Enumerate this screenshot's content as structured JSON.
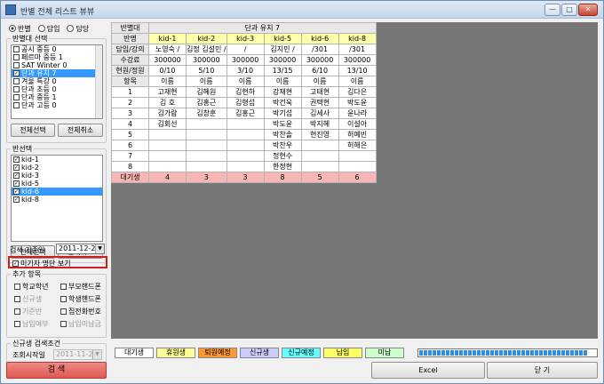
{
  "window": {
    "title": "반별 전체 리스트 뷰뷰",
    "min": "—",
    "max": "□",
    "close": "✕"
  },
  "radios": [
    {
      "label": "반별",
      "checked": true
    },
    {
      "label": "담임",
      "checked": false
    },
    {
      "label": "담당",
      "checked": false
    }
  ],
  "class_select": {
    "title": "반별대 선택",
    "items": [
      {
        "label": "공시 중등 0",
        "checked": false,
        "selected": false
      },
      {
        "label": "페르마 중등 1",
        "checked": false,
        "selected": false
      },
      {
        "label": "SAT Winter 0",
        "checked": false,
        "selected": false
      },
      {
        "label": "단과 유치 7",
        "checked": true,
        "selected": true
      },
      {
        "label": "겨울 특강 0",
        "checked": false,
        "selected": false
      },
      {
        "label": "단과 초등 0",
        "checked": false,
        "selected": false
      },
      {
        "label": "단과 중등 1",
        "checked": false,
        "selected": false
      },
      {
        "label": "단과 고등 0",
        "checked": false,
        "selected": false
      }
    ],
    "select_all": "전체선택",
    "clear_all": "전체취소"
  },
  "class_list": {
    "title": "반선택",
    "items": [
      {
        "label": "kid-1",
        "checked": true,
        "selected": false
      },
      {
        "label": "kid-2",
        "checked": true,
        "selected": false
      },
      {
        "label": "kid-3",
        "checked": true,
        "selected": false
      },
      {
        "label": "kid-5",
        "checked": true,
        "selected": false
      },
      {
        "label": "kid-6",
        "checked": true,
        "selected": true
      },
      {
        "label": "kid-8",
        "checked": true,
        "selected": false
      }
    ],
    "select_all": "전체선택",
    "clear_all": "전체취소"
  },
  "search": {
    "date_label": "검색 기준일",
    "date_value": "2011-12-29",
    "preview_label": "미기자 명단 보기"
  },
  "extra_items": {
    "title": "추가 항목",
    "items": [
      {
        "label": "학교학년",
        "checked": false,
        "active": true
      },
      {
        "label": "부모핸드폰",
        "checked": false,
        "active": true
      },
      {
        "label": "신규생",
        "checked": false,
        "active": false
      },
      {
        "label": "학생핸드폰",
        "checked": false,
        "active": true
      },
      {
        "label": "기준반",
        "checked": false,
        "active": false
      },
      {
        "label": "집전화번호",
        "checked": false,
        "active": true
      },
      {
        "label": "납입여부",
        "checked": false,
        "active": false
      },
      {
        "label": "납입미납금",
        "checked": false,
        "active": false
      }
    ]
  },
  "new_search": {
    "title": "신규생 검색조건",
    "start_label": "조회시작일",
    "start_value": "2011-11-29",
    "end_label": "조회종료일",
    "end_value": "2011-12-29"
  },
  "search_button": "검 색",
  "grid": {
    "group_header": [
      "반별대",
      "단과 유치 7"
    ],
    "row_labels": [
      "반명",
      "담임/강의",
      "수강료",
      "현원/정원",
      "항목"
    ],
    "numbers": [
      "1",
      "2",
      "3",
      "4",
      "5",
      "6",
      "7",
      "8"
    ],
    "wait_label": "대기생",
    "columns": [
      {
        "class": "kid-1",
        "teacher": "노영숙 /",
        "fee": "300000",
        "count": "0/10",
        "item": "이름",
        "students": [
          "고재현",
          "김 호",
          "김가람",
          "김회선",
          "",
          "",
          "",
          ""
        ],
        "wait": "4"
      },
      {
        "class": "kid-2",
        "teacher": "김정 김설민 /",
        "fee": "300000",
        "count": "5/10",
        "item": "이름",
        "students": [
          "김혜원",
          "김홍근",
          "김창훈",
          "",
          "",
          "",
          "",
          ""
        ],
        "wait": "3"
      },
      {
        "class": "kid-3",
        "teacher": "/",
        "fee": "300000",
        "count": "3/10",
        "item": "이름",
        "students": [
          "김현하",
          "김형섭",
          "김홍근",
          "",
          "",
          "",
          "",
          ""
        ],
        "wait": "3"
      },
      {
        "class": "kid-5",
        "teacher": "김지민 /",
        "fee": "300000",
        "count": "13/15",
        "item": "이름",
        "students": [
          "강재현",
          "박건욱",
          "박기섭",
          "박도윤",
          "박찬솔",
          "박찬우",
          "정현수",
          "한정현"
        ],
        "wait": "8"
      },
      {
        "class": "kid-6",
        "teacher": "/301",
        "fee": "300000",
        "count": "6/10",
        "item": "이름",
        "students": [
          "고태현",
          "권택현",
          "김세사",
          "박지혜",
          "현진영",
          "",
          "",
          ""
        ],
        "wait": "5"
      },
      {
        "class": "kid-8",
        "teacher": "/301",
        "fee": "300000",
        "count": "13/10",
        "item": "이름",
        "students": [
          "김다은",
          "박도윤",
          "윤나라",
          "이설아",
          "허예빈",
          "허해은",
          "",
          ""
        ],
        "wait": "6"
      }
    ]
  },
  "legend": [
    {
      "label": "대기생",
      "color": "#ffffff"
    },
    {
      "label": "휴원생",
      "color": "#ffff99"
    },
    {
      "label": "퇴원예정",
      "color": "#ff9933"
    },
    {
      "label": "신규생",
      "color": "#ccccff"
    },
    {
      "label": "신규예정",
      "color": "#66ffff"
    },
    {
      "label": "납입",
      "color": "#ffff66"
    },
    {
      "label": "미납",
      "color": "#ccffcc"
    }
  ],
  "bottom": {
    "excel": "Excel",
    "close": "닫 기"
  }
}
